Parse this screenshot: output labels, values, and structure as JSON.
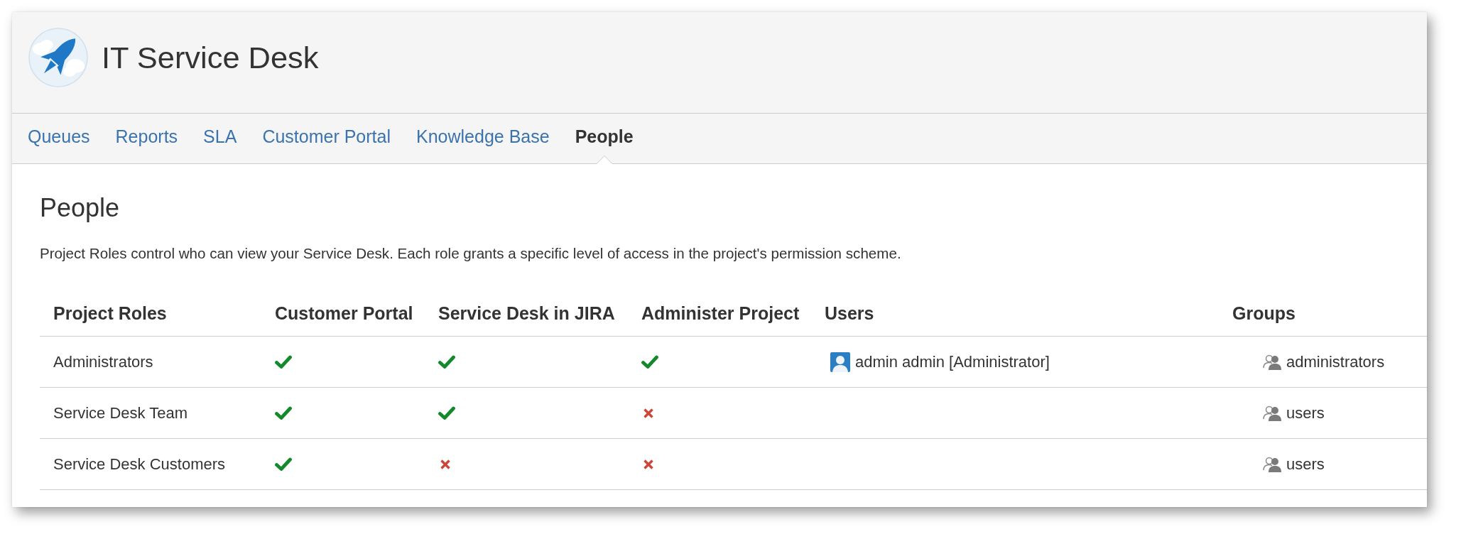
{
  "header": {
    "title": "IT Service Desk"
  },
  "tabs": [
    {
      "label": "Queues",
      "selected": false
    },
    {
      "label": "Reports",
      "selected": false
    },
    {
      "label": "SLA",
      "selected": false
    },
    {
      "label": "Customer Portal",
      "selected": false
    },
    {
      "label": "Knowledge Base",
      "selected": false
    },
    {
      "label": "People",
      "selected": true
    }
  ],
  "content": {
    "heading": "People",
    "description": "Project Roles control who can view your Service Desk. Each role grants a specific level of access in the project's permission scheme."
  },
  "table": {
    "columns": [
      "Project Roles",
      "Customer Portal",
      "Service Desk in JIRA",
      "Administer Project",
      "Users",
      "Groups"
    ],
    "rows": [
      {
        "role": "Administrators",
        "permissions": [
          {
            "granted": true
          },
          {
            "granted": true
          },
          {
            "granted": true
          }
        ],
        "users": [
          "admin admin [Administrator]"
        ],
        "groups": [
          "administrators"
        ]
      },
      {
        "role": "Service Desk Team",
        "permissions": [
          {
            "granted": true
          },
          {
            "granted": true
          },
          {
            "granted": false
          }
        ],
        "groups": [
          "users"
        ]
      },
      {
        "role": "Service Desk Customers",
        "permissions": [
          {
            "granted": true
          },
          {
            "granted": false
          },
          {
            "granted": false
          }
        ],
        "groups": [
          "users"
        ]
      }
    ]
  }
}
